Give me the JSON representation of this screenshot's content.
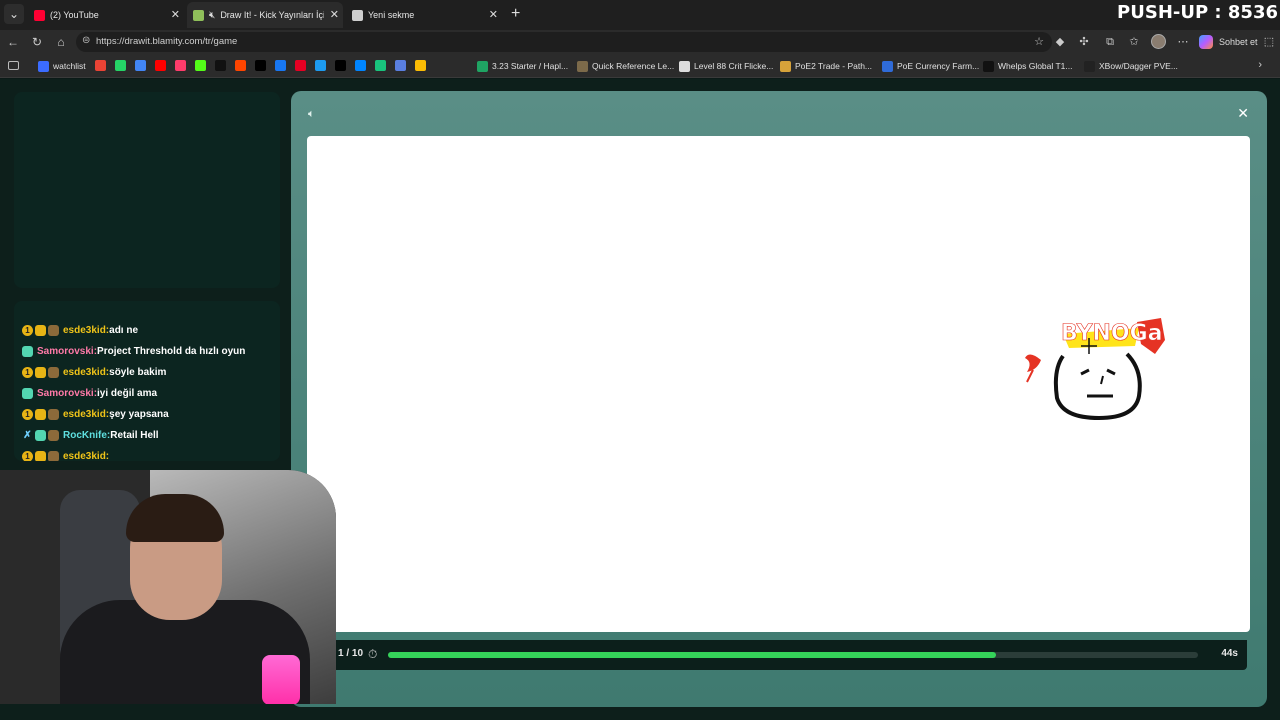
{
  "browser": {
    "tabs": [
      {
        "title": "(2) YouTube",
        "favicon_color": "#ff0033"
      },
      {
        "title": "Draw It! - Kick Yayınları İçin Ç",
        "favicon_color": "#8fbf5a",
        "muted": true
      },
      {
        "title": "Yeni sekme",
        "favicon_color": "#cfcfcf"
      }
    ],
    "url": "https://drawit.blamity.com/tr/game",
    "sidebar_button_label": "Sohbet et",
    "overlay_text": "PUSH-UP : 8536"
  },
  "bookmarks": {
    "named": [
      {
        "label": "watchlist",
        "icon_color": "#3b6cff"
      },
      {
        "label": "3.23 Starter / Hapl...",
        "icon_color": "#1fa463"
      },
      {
        "label": "Quick Reference Le...",
        "icon_color": "#7c6a4a"
      },
      {
        "label": "Level 88 Crit Flicke...",
        "icon_color": "#dddddd"
      },
      {
        "label": "PoE2 Trade - Path...",
        "icon_color": "#d6a23a"
      },
      {
        "label": "PoE Currency Farm...",
        "icon_color": "#2f6bd8"
      },
      {
        "label": "Whelps Global T1...",
        "icon_color": "#111111"
      },
      {
        "label": "XBow/Dagger PVE...",
        "icon_color": "#222222"
      }
    ],
    "icon_colors": [
      "#ea4335",
      "#25d366",
      "#4285f4",
      "#ff0000",
      "#ff3c6b",
      "#53fc18",
      "#111111",
      "#ff4500",
      "#000000",
      "#1877f2",
      "#e60023",
      "#1d9bf0",
      "#000000",
      "#0085ff",
      "#19c37d",
      "#5a7fe0",
      "#fbbc04"
    ]
  },
  "chat": {
    "messages": [
      {
        "user": "esde3kid",
        "text": "adı ne",
        "color": "#f0c419",
        "badges": [
          "num",
          "crown",
          "chest"
        ]
      },
      {
        "user": "Samorovski",
        "text": "Project Threshold da hızlı oyun",
        "color": "#ff7aa8",
        "badges": [
          "tg"
        ]
      },
      {
        "user": "esde3kid",
        "text": "söyle bakim",
        "color": "#f0c419",
        "badges": [
          "num",
          "crown",
          "chest"
        ]
      },
      {
        "user": "Samorovski",
        "text": "iyi değil ama",
        "color": "#ff7aa8",
        "badges": [
          "tg"
        ]
      },
      {
        "user": "esde3kid",
        "text": "şey yapsana",
        "color": "#f0c419",
        "badges": [
          "num",
          "crown",
          "chest"
        ]
      },
      {
        "user": "RocKnife",
        "text": "Retail Hell",
        "color": "#5fe0e0",
        "badges": [
          "sword",
          "tg",
          "chest"
        ]
      },
      {
        "user": "esde3kid",
        "text": "",
        "color": "#f0c419",
        "badges": [
          "num",
          "crown",
          "chest"
        ]
      }
    ]
  },
  "game": {
    "round": "1 / 10",
    "time_left": "44s",
    "progress": 0.75,
    "progress_color": "#35d35a"
  }
}
